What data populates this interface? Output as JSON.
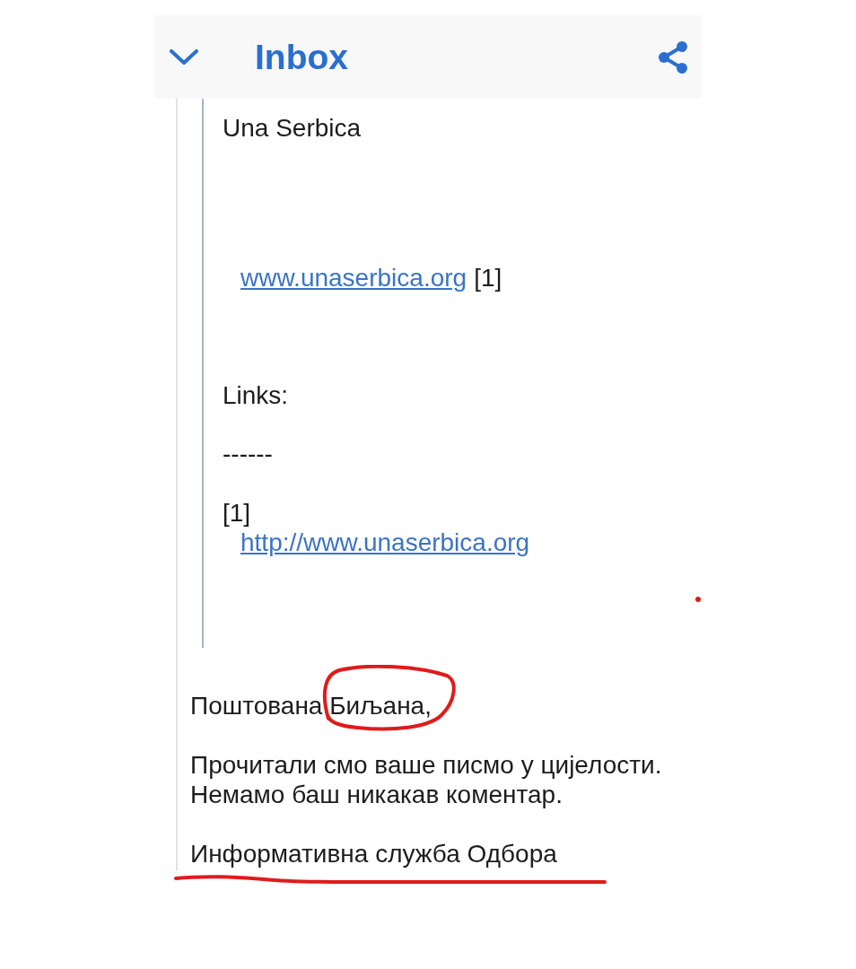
{
  "app_bar": {
    "title": "Inbox"
  },
  "quoted_message": {
    "blocks": [
      {
        "kind": "text",
        "text": "Una Serbica"
      },
      {
        "kind": "link",
        "link": "www.unaserbica.org",
        "note": "[1]"
      },
      {
        "kind": "text",
        "text": "Links:"
      },
      {
        "kind": "text",
        "text": "------"
      },
      {
        "kind": "reference",
        "note": "[1]",
        "link": "http://www.unaserbica.org"
      }
    ]
  },
  "reply": {
    "greeting": "Поштована Биљана,",
    "body_lines": [
      "Прочитали смо ваше писмо у цијелости.",
      "Немамо баш никакав коментар."
    ],
    "signature": "Информативна служба Одбора"
  }
}
